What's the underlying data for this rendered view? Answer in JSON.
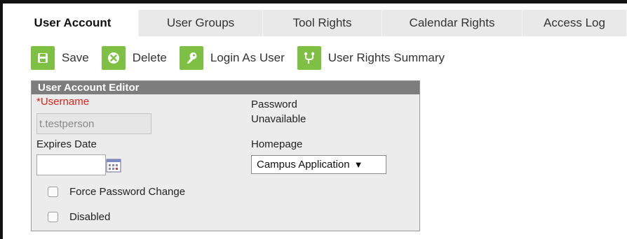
{
  "tabs": [
    {
      "label": "User Account",
      "active": true
    },
    {
      "label": "User Groups",
      "active": false
    },
    {
      "label": "Tool Rights",
      "active": false
    },
    {
      "label": "Calendar Rights",
      "active": false
    },
    {
      "label": "Access Log",
      "active": false
    }
  ],
  "toolbar": {
    "save": "Save",
    "delete": "Delete",
    "login_as_user": "Login As User",
    "user_rights_summary": "User Rights Summary"
  },
  "editor": {
    "title": "User Account Editor",
    "username_required_mark": "*",
    "username_label": "Username",
    "username_value": "t.testperson",
    "password_label": "Password",
    "password_value": "Unavailable",
    "expires_label": "Expires Date",
    "expires_value": "",
    "homepage_label": "Homepage",
    "homepage_value": "Campus Application",
    "force_password_change": "Force Password Change",
    "disabled": "Disabled"
  },
  "colors": {
    "accent_green": "#7ec043",
    "header_gray": "#7d7d7d",
    "required_red": "#e4211b"
  }
}
